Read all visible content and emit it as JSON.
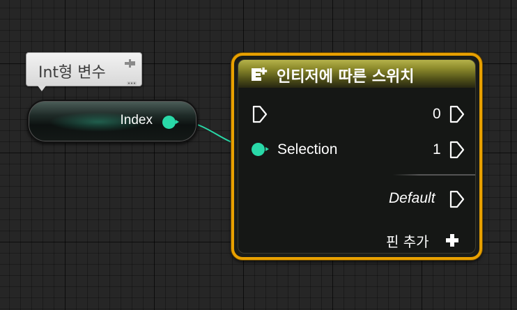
{
  "comment": {
    "text": "Int형 변수"
  },
  "variable_node": {
    "output_label": "Index",
    "pin_color": "#29d9a8"
  },
  "switch_node": {
    "title": "인티저에 따른 스위치",
    "header_icon": "switch-icon",
    "input_label": "Selection",
    "outputs": [
      "0",
      "1"
    ],
    "default_label": "Default",
    "add_pin_label": "핀 추가",
    "border_color": "#e8a000"
  }
}
